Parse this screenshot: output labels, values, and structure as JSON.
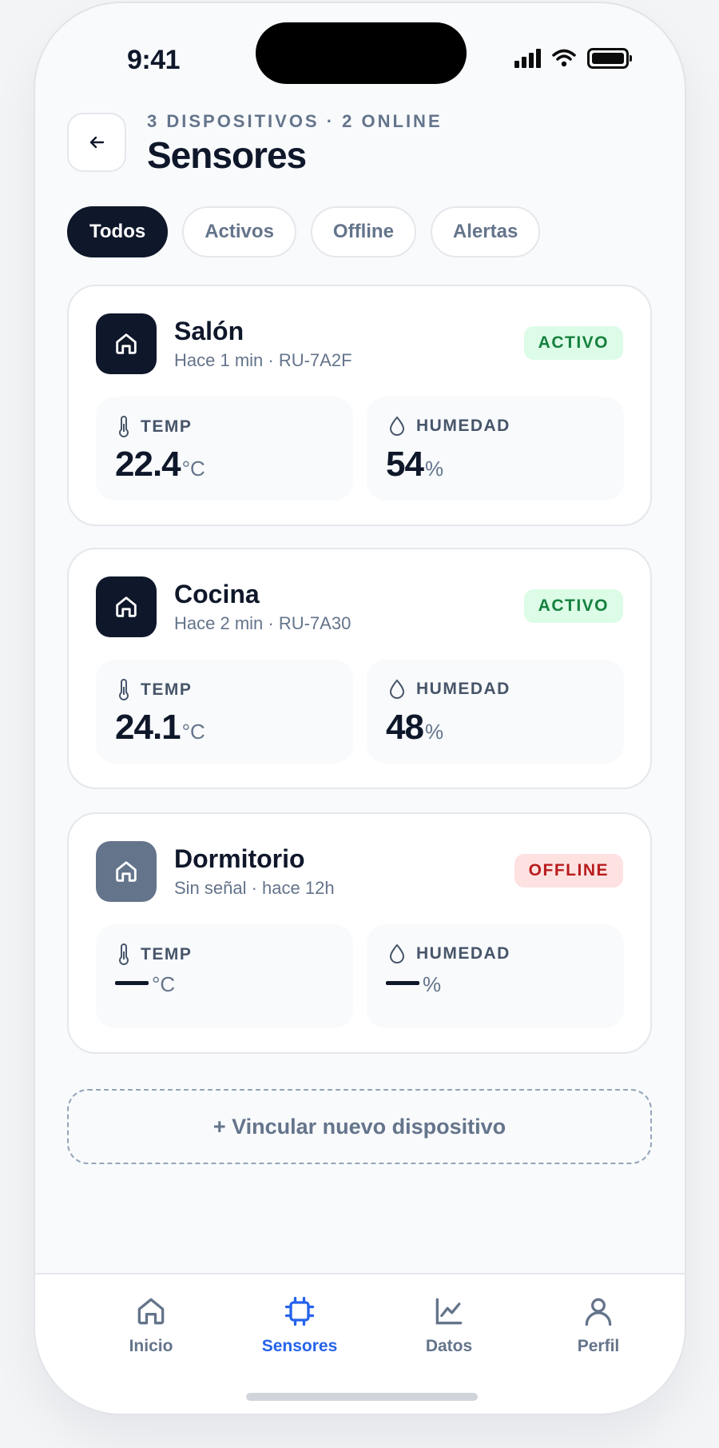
{
  "status_bar": {
    "time": "9:41"
  },
  "header": {
    "overline": "3 DISPOSITIVOS · 2 ONLINE",
    "title": "Sensores"
  },
  "filters": [
    {
      "label": "Todos",
      "active": true
    },
    {
      "label": "Activos",
      "active": false
    },
    {
      "label": "Offline",
      "active": false
    },
    {
      "label": "Alertas",
      "active": false
    }
  ],
  "devices": [
    {
      "name": "Salón",
      "subtitle": "Hace 1 min · RU-7A2F",
      "status": "ACTIVO",
      "temp_label": "TEMP",
      "temp_value": "22.4",
      "temp_unit": "°C",
      "hum_label": "HUMEDAD",
      "hum_value": "54",
      "hum_unit": "%"
    },
    {
      "name": "Cocina",
      "subtitle": "Hace 2 min · RU-7A30",
      "status": "ACTIVO",
      "temp_label": "TEMP",
      "temp_value": "24.1",
      "temp_unit": "°C",
      "hum_label": "HUMEDAD",
      "hum_value": "48",
      "hum_unit": "%"
    },
    {
      "name": "Dormitorio",
      "subtitle": "Sin señal · hace 12h",
      "status": "OFFLINE",
      "temp_label": "TEMP",
      "temp_unit": "°C",
      "hum_label": "HUMEDAD",
      "hum_unit": "%"
    }
  ],
  "link_device_label": "+ Vincular nuevo dispositivo",
  "tabbar": [
    {
      "label": "Inicio",
      "icon": "home-icon",
      "active": false
    },
    {
      "label": "Sensores",
      "icon": "chip-icon",
      "active": true
    },
    {
      "label": "Datos",
      "icon": "chart-icon",
      "active": false
    },
    {
      "label": "Perfil",
      "icon": "user-icon",
      "active": false
    }
  ],
  "colors": {
    "primary_dark": "#0f172a",
    "accent": "#2563eb",
    "active_bg": "#dcfce7",
    "active_text": "#15803d",
    "offline_bg": "#fee2e2",
    "offline_text": "#b91c1c"
  }
}
